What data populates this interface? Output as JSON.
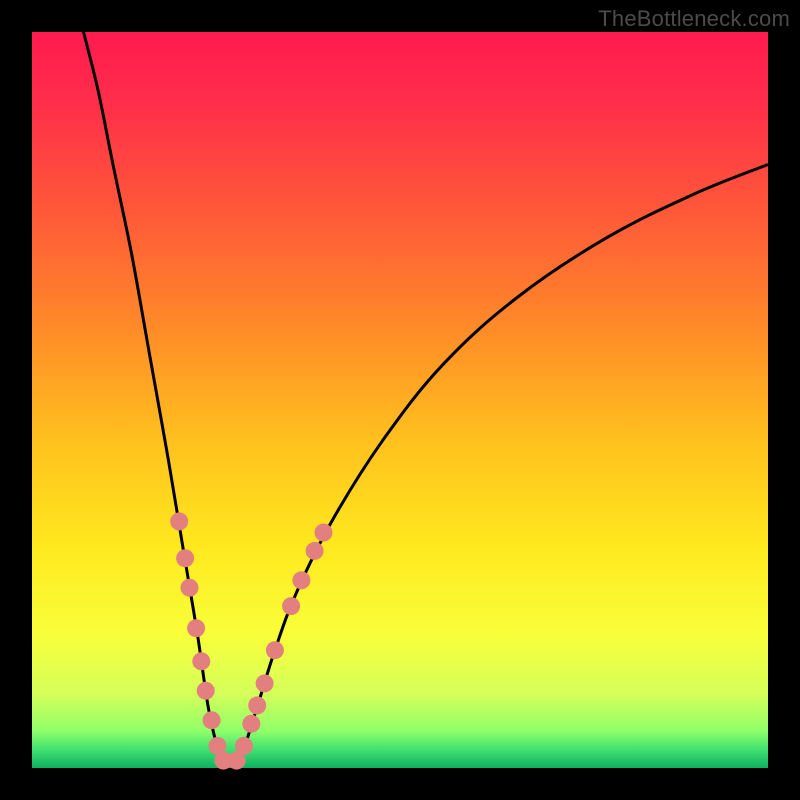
{
  "watermark": "TheBottleneck.com",
  "colors": {
    "frame": "#000000",
    "dot": "#e37f7f",
    "curve": "#000000",
    "gradient_stops": [
      {
        "pct": 0.0,
        "color": "#ff1a4f"
      },
      {
        "pct": 0.1,
        "color": "#ff2f4a"
      },
      {
        "pct": 0.25,
        "color": "#ff5a38"
      },
      {
        "pct": 0.4,
        "color": "#ff8a28"
      },
      {
        "pct": 0.55,
        "color": "#ffbf1e"
      },
      {
        "pct": 0.7,
        "color": "#ffe91e"
      },
      {
        "pct": 0.82,
        "color": "#f8ff3a"
      },
      {
        "pct": 0.9,
        "color": "#d4ff5a"
      },
      {
        "pct": 0.95,
        "color": "#8fff6a"
      },
      {
        "pct": 0.975,
        "color": "#40e070"
      },
      {
        "pct": 1.0,
        "color": "#10b060"
      }
    ]
  },
  "chart_data": {
    "type": "line",
    "title": "",
    "xlabel": "",
    "ylabel": "",
    "xlim": [
      0,
      100
    ],
    "ylim": [
      0,
      100
    ],
    "description": "V-shaped bottleneck curve. Y maps to gradient hue (0 at bottom = green/optimal, 100 at top = red/severe). Minimum near x≈26, y≈0. Left branch is steep/near-vertical at top-left; right branch rises more gently toward top-right.",
    "series": [
      {
        "name": "bottleneck-curve",
        "points": [
          {
            "x": 7.0,
            "y": 100.0
          },
          {
            "x": 9.0,
            "y": 92.0
          },
          {
            "x": 11.0,
            "y": 82.0
          },
          {
            "x": 13.5,
            "y": 70.0
          },
          {
            "x": 16.0,
            "y": 56.0
          },
          {
            "x": 18.5,
            "y": 42.0
          },
          {
            "x": 20.5,
            "y": 30.0
          },
          {
            "x": 22.5,
            "y": 18.0
          },
          {
            "x": 24.0,
            "y": 8.0
          },
          {
            "x": 25.5,
            "y": 2.0
          },
          {
            "x": 27.0,
            "y": 0.5
          },
          {
            "x": 28.5,
            "y": 2.0
          },
          {
            "x": 30.5,
            "y": 8.0
          },
          {
            "x": 33.0,
            "y": 16.0
          },
          {
            "x": 36.0,
            "y": 24.0
          },
          {
            "x": 41.0,
            "y": 34.0
          },
          {
            "x": 48.0,
            "y": 45.0
          },
          {
            "x": 56.0,
            "y": 55.0
          },
          {
            "x": 66.0,
            "y": 64.0
          },
          {
            "x": 78.0,
            "y": 72.0
          },
          {
            "x": 90.0,
            "y": 78.0
          },
          {
            "x": 100.0,
            "y": 82.0
          }
        ]
      },
      {
        "name": "highlighted-dots",
        "points": [
          {
            "x": 20.0,
            "y": 33.5
          },
          {
            "x": 20.8,
            "y": 28.5
          },
          {
            "x": 21.4,
            "y": 24.5
          },
          {
            "x": 22.3,
            "y": 19.0
          },
          {
            "x": 23.0,
            "y": 14.5
          },
          {
            "x": 23.6,
            "y": 10.5
          },
          {
            "x": 24.4,
            "y": 6.5
          },
          {
            "x": 25.2,
            "y": 3.0
          },
          {
            "x": 26.0,
            "y": 1.0
          },
          {
            "x": 27.8,
            "y": 1.0
          },
          {
            "x": 28.8,
            "y": 3.0
          },
          {
            "x": 29.8,
            "y": 6.0
          },
          {
            "x": 30.6,
            "y": 8.5
          },
          {
            "x": 31.6,
            "y": 11.5
          },
          {
            "x": 33.0,
            "y": 16.0
          },
          {
            "x": 35.2,
            "y": 22.0
          },
          {
            "x": 36.6,
            "y": 25.5
          },
          {
            "x": 38.4,
            "y": 29.5
          },
          {
            "x": 39.6,
            "y": 32.0
          }
        ]
      }
    ]
  }
}
